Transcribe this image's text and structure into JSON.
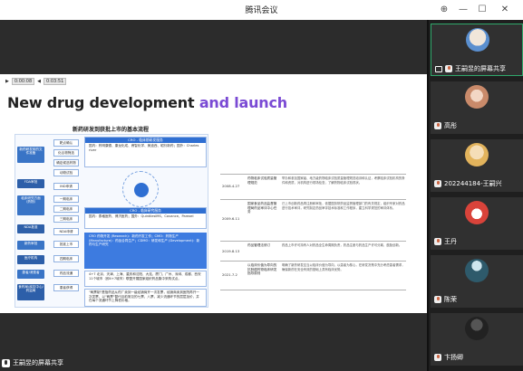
{
  "app": {
    "title": "腾讯会议"
  },
  "slide": {
    "controls": [
      "0:00:08",
      "0:03:51"
    ],
    "heading_main": "New drug development ",
    "heading_accent": "and launch",
    "flow_title": "新药研发到获批上市的基本流程",
    "left_col": [
      "新药研发前的文件准备",
      "FDA审批",
      "临床研究方面（药物）",
      "NDA批准",
      "新药审批",
      "医疗机构",
      "患者/消费者",
      "食药局/疾控中心/药监局"
    ],
    "steps": [
      "靶点确认",
      "化合物筛选",
      "确定候选药物",
      "动物试验",
      "IND申请",
      "一期临床",
      "二期临床",
      "三期临床",
      "NDA申请",
      "批准上市",
      "四期临床",
      "药品流通",
      "患者获得"
    ],
    "panels": [
      {
        "header": "CRO - 临床前研发服务",
        "body": "国内：药明康德、康龙化成、睿智化学、美迪西、昭衍新药；国外：Charles river"
      },
      {
        "header": "CRO - 临床研究服务",
        "body": "国内：泰格医药、博济医药；国外：QuintilesIMS、Covance、Parexel"
      },
      {
        "header": "",
        "body": "CRO 药物开发 (Research)：新药开发工作；CMO：药物生产 (Manufacture)：药品合同生产；CDMO：研发和生产 (Development)：新药与生产研究"
      },
      {
        "header": "",
        "body": "4+7 北京、天津、上海、重庆和沈阳、大连、厦门、广州、深圳、成都、西安11个城市（即4+7城市）联盟开展国家组织药品集中采购试点。"
      },
      {
        "header": "",
        "body": "\"两票制\"是指药品从药厂卖到一级经销商开一次发票，经销商卖到医院再开一次发票，以\"两票\"替代目前常见的七票、八票，减少流通环节的层层加价，并在每个流通环节上降低价格。"
      }
    ],
    "table": [
      {
        "year": "2008.4.27",
        "event": "药物临床试验质量管理规范",
        "detail": "举办和参加国家级、地方级药物临床试验质量管理规范培训和认证，考察临床试验机构的条件和资质，对机构进行现场检查，了解药物临床试验现状。"
      },
      {
        "year": "2009.6.11",
        "event": "国家食品药品监督管理局药品审评中心任务",
        "detail": "已上市创新药品再注册和审批，依据国务院药品监督管理部门的有关规定，组织专家对药品进行技术审评，研究制定药品审评技术标准和工作程序，建立科学规范的审评体系。"
      },
      {
        "year": "2019.8.13",
        "event": "药品管理法修订",
        "detail": "药品上市许可持有人对药品全生命周期负责，药品注册与药品生产许可分离，鼓励创新。"
      },
      {
        "year": "2021.7.2",
        "event": "以临床价值为导向的抗肿瘤药物临床研发指导原则",
        "detail": "明确了新药研发应当以临床价值为导向，以患者为核心，在研发决策中充分考虑患者需求，确保新药在安全有效的基础上具有临床优势。"
      }
    ]
  },
  "presenter_bar": {
    "label": "王嗣昱的屏幕共享"
  },
  "participants": [
    {
      "name": "王嗣昱的屏幕共享",
      "sharing": true,
      "avatar_color": "#5a8fcf"
    },
    {
      "name": "高彤",
      "sharing": false,
      "avatar_color": "#c98a6a"
    },
    {
      "name": "202244184-王嗣兴",
      "sharing": false,
      "avatar_color": "#e2b35c"
    },
    {
      "name": "王丹",
      "sharing": false,
      "avatar_color": "#d9433a"
    },
    {
      "name": "陈荣",
      "sharing": false,
      "avatar_color": "#2e5a6b"
    },
    {
      "name": "卞扬卿",
      "sharing": false,
      "avatar_color": "#222222"
    }
  ]
}
